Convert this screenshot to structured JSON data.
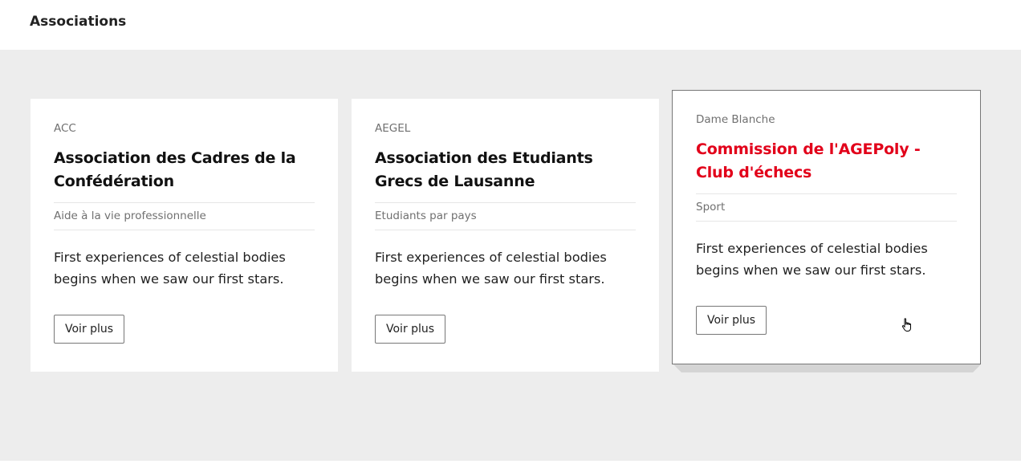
{
  "header": {
    "title": "Associations"
  },
  "colors": {
    "accent": "#e2001a",
    "background": "#ededed"
  },
  "cards": [
    {
      "abbr": "ACC",
      "title": "Association des Cadres de la Confédération",
      "category": "Aide à la vie professionnelle",
      "description": "First experiences of celestial bodies begins when we saw our first stars.",
      "button": "Voir plus"
    },
    {
      "abbr": "AEGEL",
      "title": "Association des Etudiants Grecs de Lausanne",
      "category": "Etudiants par pays",
      "description": "First experiences of celestial bodies begins when we saw our first stars.",
      "button": "Voir plus"
    },
    {
      "abbr": "Dame Blanche",
      "title": "Commission de l'AGEPoly - Club d'échecs",
      "category": "Sport",
      "description": "First experiences of celestial bodies begins when we saw our first stars.",
      "button": "Voir plus",
      "hovered": true
    }
  ],
  "cursor": "hand-pointer-icon"
}
